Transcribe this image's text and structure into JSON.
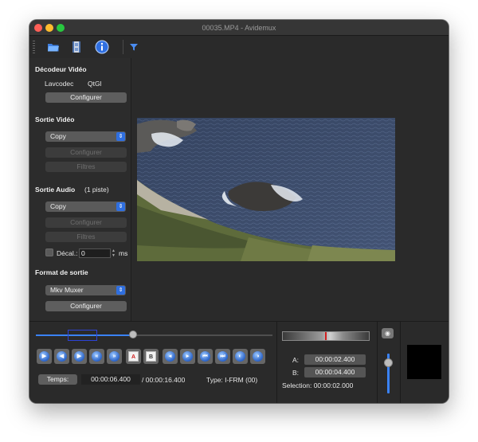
{
  "window": {
    "title": "00035.MP4 - Avidemux"
  },
  "toolbar": {
    "icons": [
      "open-folder-icon",
      "save-film-icon",
      "info-icon",
      "filter-icon"
    ]
  },
  "sidebar": {
    "video_decoder": {
      "title": "Décodeur Vidéo",
      "codec1": "Lavcodec",
      "codec2": "QtGl",
      "configure": "Configurer"
    },
    "video_output": {
      "title": "Sortie Vidéo",
      "codec": "Copy",
      "configure": "Configurer",
      "filters": "Filtres"
    },
    "audio_output": {
      "title": "Sortie Audio",
      "tracks": "(1 piste)",
      "codec": "Copy",
      "configure": "Configurer",
      "filters": "Filtres",
      "shift_label": "Décal.:",
      "shift_value": "0",
      "shift_unit": "ms"
    },
    "output_format": {
      "title": "Format de sortie",
      "muxer": "Mkv Muxer",
      "configure": "Configurer"
    }
  },
  "playback": {
    "position_fraction": 0.41,
    "selection_start_fraction": 0.135,
    "selection_end_fraction": 0.26,
    "time_label": "Temps:",
    "current_time": "00:00:06.400",
    "total_time": "/ 00:00:16.400",
    "frame_type": "Type:  I-FRM (00)",
    "buttons": [
      "play-icon",
      "previous-frame-icon",
      "next-frame-icon",
      "rewind-icon",
      "fast-forward-icon",
      "mark-a-icon",
      "mark-b-icon",
      "previous-keyframe-icon",
      "next-keyframe-icon",
      "goto-start-icon",
      "goto-end-icon",
      "previous-black-frame-icon",
      "next-black-frame-icon"
    ]
  },
  "selection": {
    "a_label": "A:",
    "a_value": "00:00:02.400",
    "b_label": "B:",
    "b_value": "00:00:04.400",
    "selection_text": "Selection: 00:00:02.000"
  },
  "volume": {
    "level": 0.78
  }
}
